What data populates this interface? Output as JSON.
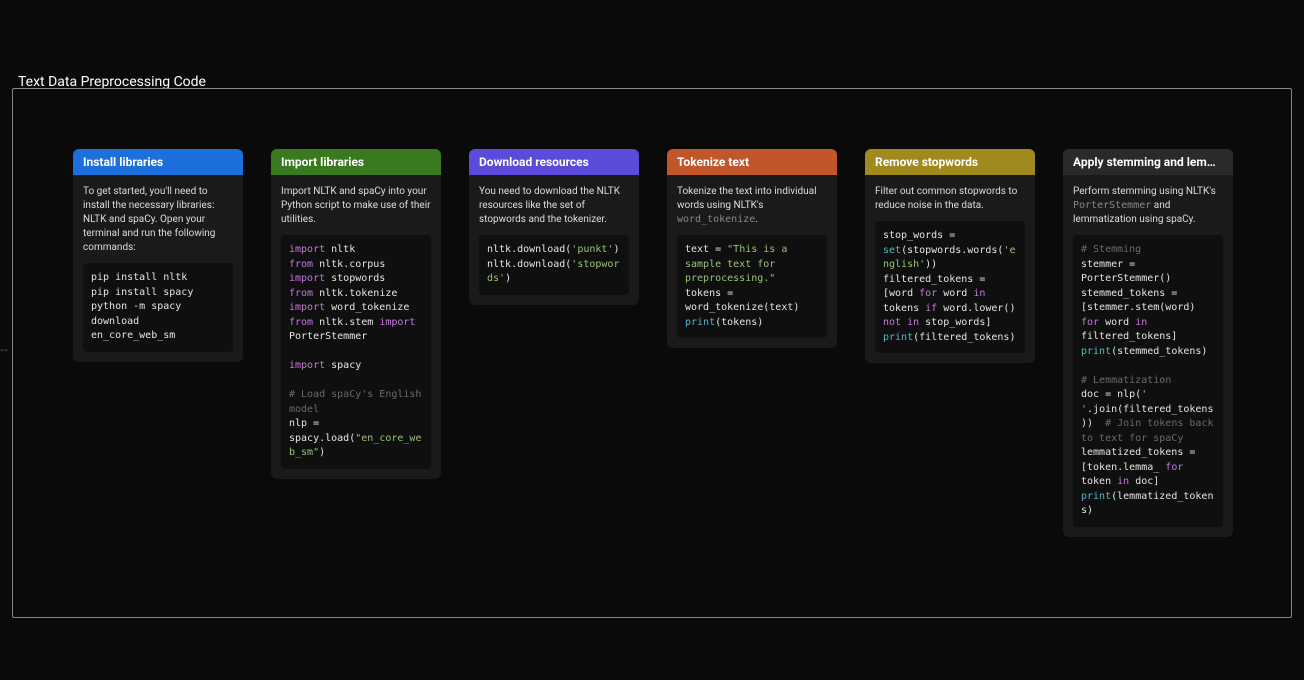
{
  "title": "Text Data Preprocessing Code",
  "cards": [
    {
      "header": "Install libraries",
      "headerClass": "hdr-blue",
      "desc_html": "To get started, you'll need to install the necessary libraries: NLTK and spaCy. Open your terminal and run the following commands:",
      "code_html": "pip install nltk\npip install spacy\npython -m spacy download en_core_web_sm"
    },
    {
      "header": "Import libraries",
      "headerClass": "hdr-green",
      "desc_html": "Import NLTK and spaCy into your Python script to make use of their utilities.",
      "code_html": "<span class=\"kw\">import</span> nltk\n<span class=\"kw\">from</span> nltk.corpus <span class=\"kw\">import</span> stopwords\n<span class=\"kw\">from</span> nltk.tokenize <span class=\"kw\">import</span> word_tokenize\n<span class=\"kw\">from</span> nltk.stem <span class=\"kw\">import</span> PorterStemmer\n\n<span class=\"kw\">import</span> spacy\n\n<span class=\"cmt\"># Load spaCy's English model</span>\nnlp = spacy.load(<span class=\"str\">\"en_core_web_sm\"</span>)"
    },
    {
      "header": "Download resources",
      "headerClass": "hdr-purple",
      "desc_html": "You need to download the NLTK resources like the set of stopwords and the tokenizer.",
      "code_html": "nltk.download(<span class=\"str\">'punkt'</span>)\nnltk.download(<span class=\"str\">'stopwords'</span>)"
    },
    {
      "header": "Tokenize text",
      "headerClass": "hdr-orange",
      "desc_html": "Tokenize the text into individual words using NLTK's <span class=\"inline-code\">word_tokenize</span>.",
      "code_html": "text = <span class=\"str\">\"This is a sample text for preprocessing.\"</span>\ntokens = word_tokenize(text)\n<span class=\"bi\">print</span>(tokens)"
    },
    {
      "header": "Remove stopwords",
      "headerClass": "hdr-olive",
      "desc_html": "Filter out common stopwords to reduce noise in the data.",
      "code_html": "stop_words = <span class=\"bi\">set</span>(stopwords.words(<span class=\"str\">'english'</span>))\nfiltered_tokens = [word <span class=\"kw\">for</span> word <span class=\"kw\">in</span> tokens <span class=\"kw\">if</span> word.lower() <span class=\"kw\">not</span> <span class=\"kw\">in</span> stop_words]\n<span class=\"bi\">print</span>(filtered_tokens)"
    },
    {
      "header": "Apply stemming and lem…",
      "headerClass": "hdr-dark",
      "desc_html": "Perform stemming using NLTK's <span class=\"inline-code\">PorterStemmer</span> and lemmatization using spaCy.",
      "code_html": "<span class=\"cmt\"># Stemming</span>\nstemmer = PorterStemmer()\nstemmed_tokens = [stemmer.stem(word) <span class=\"kw\">for</span> word <span class=\"kw\">in</span> filtered_tokens]\n<span class=\"bi\">print</span>(stemmed_tokens)\n\n<span class=\"cmt\"># Lemmatization</span>\ndoc = nlp(<span class=\"str\">' '</span>.join(filtered_tokens))  <span class=\"cmt\"># Join tokens back to text for spaCy</span>\nlemmatized_tokens = [token.lemma_ <span class=\"kw\">for</span> token <span class=\"kw\">in</span> doc]\n<span class=\"bi\">print</span>(lemmatized_tokens)"
    }
  ]
}
